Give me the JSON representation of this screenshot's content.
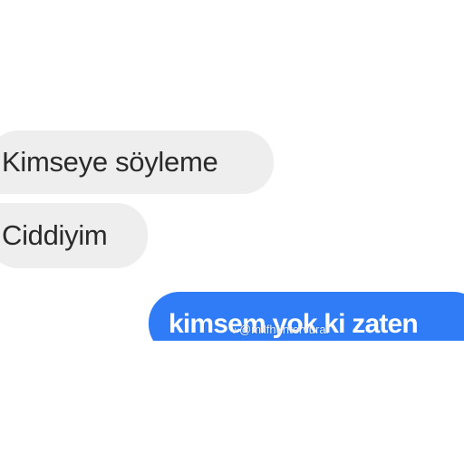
{
  "conversation": {
    "received_messages": [
      {
        "text": "Kimseye söyleme"
      },
      {
        "text": "Ciddiyim"
      }
    ],
    "sent_messages": [
      {
        "text": "kimsem yok ki zaten"
      }
    ]
  },
  "watermark": {
    "icon": "music-note-icon",
    "handle": "@milfhuntervural"
  },
  "colors": {
    "sent_bubble": "#2f7cf6",
    "received_bubble": "#eeeeef",
    "background": "#ffffff"
  }
}
